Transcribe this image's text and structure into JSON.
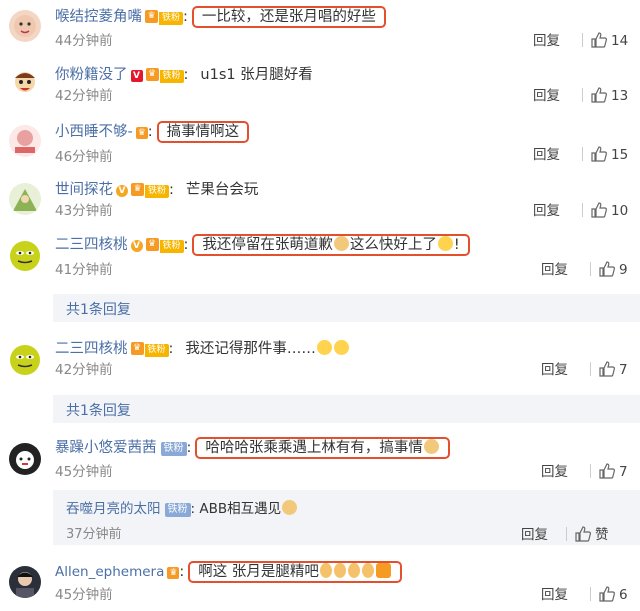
{
  "colors": {
    "link": "#4b6fa6",
    "highlight_border": "#e4502e",
    "reply_bg": "#f2f4f7"
  },
  "comments": [
    {
      "user": "喉结控菱角嘴",
      "badge_text": "铁粉",
      "text": "一比较，还是张月唱的好些",
      "time": "44分钟前",
      "reply_label": "回复",
      "likes": "14"
    },
    {
      "user": "你粉籍没了",
      "badge_text": "铁粉",
      "text": "u1s1 张月腿好看",
      "time": "42分钟前",
      "reply_label": "回复",
      "likes": "13"
    },
    {
      "user": "小西睡不够-",
      "text": "搞事情啊这",
      "time": "46分钟前",
      "reply_label": "回复",
      "likes": "15"
    },
    {
      "user": "世间探花",
      "badge_text": "铁粉",
      "text": "芒果台会玩",
      "time": "43分钟前",
      "reply_label": "回复",
      "likes": "10"
    },
    {
      "user": "二三四核桃",
      "badge_text": "铁粉",
      "text_a": "我还停留在张萌道歉",
      "text_b": "这么快好上了",
      "text_c": "!",
      "time": "41分钟前",
      "reply_label": "回复",
      "likes": "9",
      "sub_replies": "共1条回复"
    },
    {
      "user": "二三四核桃",
      "badge_text": "铁粉",
      "text": "我还记得那件事……",
      "time": "42分钟前",
      "reply_label": "回复",
      "likes": "7",
      "sub_replies": "共1条回复"
    },
    {
      "user": "暴躁小悠爱茜茜",
      "badge_text": "铁粉",
      "text": "哈哈哈张乘乘遇上林有有，搞事情",
      "time": "45分钟前",
      "reply_label": "回复",
      "likes": "7"
    },
    {
      "user": "Allen_ephemera",
      "text": "啊这 张月是腿精吧",
      "time": "45分钟前",
      "reply_label": "回复",
      "likes": "6"
    }
  ],
  "nested_reply": {
    "user": "吞噬月亮的太阳",
    "badge_text": "铁粉",
    "text": "ABB相互遇见",
    "time": "37分钟前",
    "reply_label": "回复",
    "like_label": "赞"
  }
}
